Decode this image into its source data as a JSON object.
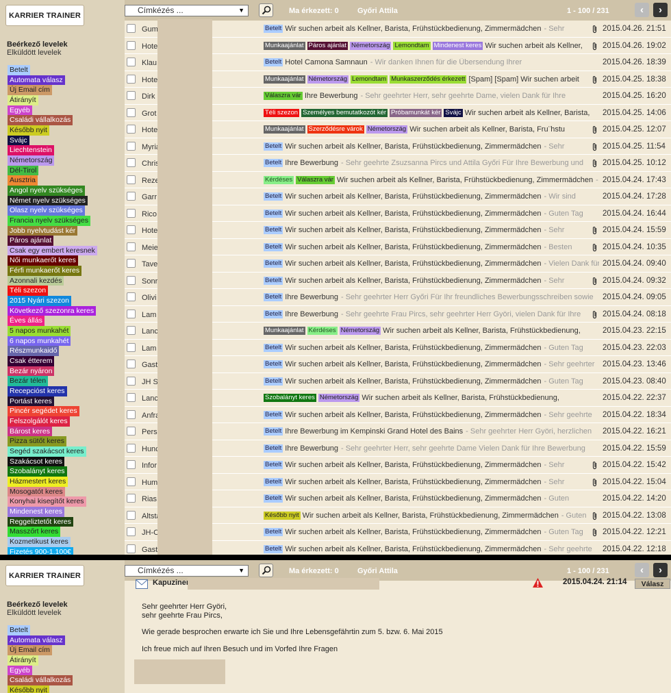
{
  "brand": "KARRIER TRAINER",
  "nav": {
    "inbox": "Beérkező levelek",
    "sent": "Elküldött levelek"
  },
  "labels": [
    {
      "text": "Betelt",
      "bg": "#aaccff",
      "fg": "#222"
    },
    {
      "text": "Automata válasz",
      "bg": "#6633cc",
      "fg": "#fff"
    },
    {
      "text": "Új Email cím",
      "bg": "#cc9966",
      "fg": "#222"
    },
    {
      "text": "Átirányít",
      "bg": "#ddee88",
      "fg": "#222"
    },
    {
      "text": "Egyéb",
      "bg": "#cc44cc",
      "fg": "#fff"
    },
    {
      "text": "Családi vállalkozás",
      "bg": "#aa5544",
      "fg": "#fff"
    },
    {
      "text": "Később nyit",
      "bg": "#cccc22",
      "fg": "#222"
    },
    {
      "text": "Svájc",
      "bg": "#111144",
      "fg": "#fff"
    },
    {
      "text": "Liechtenstein",
      "bg": "#dd1166",
      "fg": "#fff"
    },
    {
      "text": "Németország",
      "bg": "#bb99ee",
      "fg": "#222"
    },
    {
      "text": "Dél-Tirol",
      "bg": "#44bb44",
      "fg": "#222"
    },
    {
      "text": "Ausztria",
      "bg": "#ee8833",
      "fg": "#222"
    },
    {
      "text": "Angol nyelv szükséges",
      "bg": "#338822",
      "fg": "#fff"
    },
    {
      "text": "Német nyelv szükséges",
      "bg": "#222222",
      "fg": "#fff"
    },
    {
      "text": "Olasz nyelv szükséges",
      "bg": "#6677dd",
      "fg": "#fff"
    },
    {
      "text": "Francia nyelv szükséges",
      "bg": "#44dd44",
      "fg": "#222"
    },
    {
      "text": "Jobb nyelvtudást kér",
      "bg": "#997733",
      "fg": "#fff"
    },
    {
      "text": "Páros ajánlat",
      "bg": "#551133",
      "fg": "#fff"
    },
    {
      "text": "Csak egy embert keresnek",
      "bg": "#ccaaee",
      "fg": "#222"
    },
    {
      "text": "Női munkaerőt keres",
      "bg": "#660000",
      "fg": "#fff"
    },
    {
      "text": "Férfi munkaerőt keres",
      "bg": "#777711",
      "fg": "#fff"
    },
    {
      "text": "Azonnali kezdés",
      "bg": "#bbcc99",
      "fg": "#222"
    },
    {
      "text": "Téli szezon",
      "bg": "#ee1111",
      "fg": "#fff"
    },
    {
      "text": "2015 Nyári szezon",
      "bg": "#1188dd",
      "fg": "#fff"
    },
    {
      "text": "Következő szezonra keres",
      "bg": "#aa22dd",
      "fg": "#fff"
    },
    {
      "text": "Éves állás",
      "bg": "#ee2288",
      "fg": "#fff"
    },
    {
      "text": "5 napos munkahét",
      "bg": "#99dd33",
      "fg": "#222"
    },
    {
      "text": "6 napos munkahét",
      "bg": "#7766ee",
      "fg": "#fff"
    },
    {
      "text": "Részmunkaidő",
      "bg": "#6666aa",
      "fg": "#fff"
    },
    {
      "text": "Csak étterem",
      "bg": "#330033",
      "fg": "#fff"
    },
    {
      "text": "Bezár nyáron",
      "bg": "#cc3366",
      "fg": "#fff"
    },
    {
      "text": "Bezár télen",
      "bg": "#22bb99",
      "fg": "#222"
    },
    {
      "text": "Recepcióst keres",
      "bg": "#2233aa",
      "fg": "#fff"
    },
    {
      "text": "Portást keres",
      "bg": "#221133",
      "fg": "#fff"
    },
    {
      "text": "Pincér segédet keres",
      "bg": "#ee4433",
      "fg": "#fff"
    },
    {
      "text": "Felszolgálót keres",
      "bg": "#dd2244",
      "fg": "#fff"
    },
    {
      "text": "Bárost keres",
      "bg": "#cc3388",
      "fg": "#fff"
    },
    {
      "text": "Pizza sütőt keres",
      "bg": "#889922",
      "fg": "#222"
    },
    {
      "text": "Segéd szakácsot keres",
      "bg": "#77eecc",
      "fg": "#222"
    },
    {
      "text": "Szakácsot keres",
      "bg": "#111111",
      "fg": "#fff"
    },
    {
      "text": "Szobalányt keres",
      "bg": "#117711",
      "fg": "#fff"
    },
    {
      "text": "Házmestert keres",
      "bg": "#eeee22",
      "fg": "#222"
    },
    {
      "text": "Mosogatót keres",
      "bg": "#dd8888",
      "fg": "#222"
    },
    {
      "text": "Konyhai kisegítőt keres",
      "bg": "#ee99aa",
      "fg": "#222"
    },
    {
      "text": "Mindenest keres",
      "bg": "#9977dd",
      "fg": "#fff"
    },
    {
      "text": "Reggeliztetőt keres",
      "bg": "#224411",
      "fg": "#fff"
    },
    {
      "text": "Masszőrt keres",
      "bg": "#33dd33",
      "fg": "#222"
    },
    {
      "text": "Kozmetikust keres",
      "bg": "#aaccee",
      "fg": "#222"
    },
    {
      "text": "Fizetés 900-1.100€",
      "bg": "#11aaee",
      "fg": "#fff"
    }
  ],
  "toolbar": {
    "combo": "Címkézés ...",
    "today": "Ma érkezett: 0",
    "user": "Győri Attila",
    "range": "1 - 100 / 231",
    "prev": "‹",
    "next": "›"
  },
  "tagColors": {
    "Betelt": {
      "bg": "#aaccff",
      "fg": "#224"
    },
    "Munkaajánlat": {
      "bg": "#666666",
      "fg": "#fff"
    },
    "Páros ajánlat": {
      "bg": "#551133",
      "fg": "#fff"
    },
    "Németország": {
      "bg": "#bb99ee",
      "fg": "#222"
    },
    "Lemondtam": {
      "bg": "#99dd33",
      "fg": "#222"
    },
    "Mindenest keres": {
      "bg": "#9977dd",
      "fg": "#fff"
    },
    "Munkaszerződés érkezett": {
      "bg": "#99dd33",
      "fg": "#222"
    },
    "Válaszra vár": {
      "bg": "#66cc33",
      "fg": "#222"
    },
    "Téli szezon": {
      "bg": "#ee1111",
      "fg": "#fff"
    },
    "Személyes bemutatkozót kér": {
      "bg": "#226633",
      "fg": "#fff"
    },
    "Próbamunkát kér": {
      "bg": "#886688",
      "fg": "#fff"
    },
    "Svájc": {
      "bg": "#111144",
      "fg": "#fff"
    },
    "Szerződésre várok": {
      "bg": "#ee3311",
      "fg": "#fff"
    },
    "Kérdéses": {
      "bg": "#88ee88",
      "fg": "#225522"
    },
    "Szobalányt keres": {
      "bg": "#117711",
      "fg": "#fff"
    },
    "Később nyit": {
      "bg": "#cccc22",
      "fg": "#222"
    }
  },
  "emails": [
    {
      "sender": "Gum",
      "tags": [
        "Betelt"
      ],
      "subject": "Wir suchen arbeit als Kellner, Barista, Frühstückbedienung, Zimmermädchen",
      "preview": "- Sehr",
      "att": true,
      "date": "2015.04.26. 21:51"
    },
    {
      "sender": "Hote",
      "tags": [
        "Munkaajánlat",
        "Páros ajánlat",
        "Németország",
        "Lemondtam",
        "Mindenest keres"
      ],
      "subject": "Wir suchen arbeit als Kellner,",
      "preview": "",
      "att": true,
      "date": "2015.04.26. 19:02"
    },
    {
      "sender": "Klau",
      "tags": [
        "Betelt"
      ],
      "subject": "Hotel Camona Samnaun",
      "preview": "- Wir danken Ihnen für die Übersendung Ihrer",
      "att": false,
      "date": "2015.04.26. 18:39"
    },
    {
      "sender": "Hote",
      "tags": [
        "Munkaajánlat",
        "Németország",
        "Lemondtam",
        "Munkaszerződés érkezett"
      ],
      "subject": "[Spam] [Spam] Wir suchen arbeit",
      "preview": "",
      "att": true,
      "date": "2015.04.25. 18:38"
    },
    {
      "sender": "Dirk",
      "tags": [
        "Válaszra vár"
      ],
      "subject": "Ihre Bewerbung",
      "preview": "- Sehr geehrter Herr, sehr geehrte Dame, vielen Dank für Ihre",
      "att": false,
      "date": "2015.04.25. 16:20"
    },
    {
      "sender": "Grot",
      "tags": [
        "Téli szezon",
        "Személyes bemutatkozót kér",
        "Próbamunkát kér",
        "Svájc"
      ],
      "subject": "Wir suchen arbeit als Kellner, Barista,",
      "preview": "",
      "att": false,
      "date": "2015.04.25. 14:06"
    },
    {
      "sender": "Hote",
      "tags": [
        "Munkaajánlat",
        "Szerződésre várok",
        "Németország"
      ],
      "subject": "Wir suchen arbeit als Kellner, Barista, Fru¨hstu",
      "preview": "",
      "att": true,
      "date": "2015.04.25. 12:07"
    },
    {
      "sender": "Myria                                  izerhof St.",
      "tags": [
        "Betelt"
      ],
      "subject": "Wir suchen arbeit als Kellner, Barista, Frühstückbedienung, Zimmermädchen",
      "preview": "- Sehr",
      "att": true,
      "date": "2015.04.25. 11:54"
    },
    {
      "sender": "Chris                                  ASTORIA",
      "tags": [
        "Betelt"
      ],
      "subject": "Ihre Bewerbung",
      "preview": "- Sehr geehrte Zsuzsanna Pircs und Attila Győri Für Ihre Bewerbung und",
      "att": true,
      "date": "2015.04.25. 10:12"
    },
    {
      "sender": "Reze                                   ersee (2)",
      "tags": [
        "Kérdéses",
        "Válaszra vár"
      ],
      "subject": "Wir suchen arbeit als Kellner, Barista, Frühstückbedienung, Zimmermädchen",
      "preview": "-",
      "att": false,
      "date": "2015.04.24. 17:43"
    },
    {
      "sender": "Garr",
      "tags": [
        "Betelt"
      ],
      "subject": "Wir suchen arbeit als Kellner, Barista, Frühstückbedienung, Zimmermädchen",
      "preview": "- Wir sind",
      "att": false,
      "date": "2015.04.24. 17:28"
    },
    {
      "sender": "Rico                                   unststuben",
      "tags": [
        "Betelt"
      ],
      "subject": "Wir suchen arbeit als Kellner, Barista, Frühstückbedienung, Zimmermädchen",
      "preview": "- Guten Tag",
      "att": false,
      "date": "2015.04.24. 16:44"
    },
    {
      "sender": "Hote                                   aken",
      "tags": [
        "Betelt"
      ],
      "subject": "Wir suchen arbeit als Kellner, Barista, Frühstückbedienung, Zimmermädchen",
      "preview": "- Sehr",
      "att": true,
      "date": "2015.04.24. 15:59"
    },
    {
      "sender": "Meie",
      "tags": [
        "Betelt"
      ],
      "subject": "Wir suchen arbeit als Kellner, Barista, Frühstückbedienung, Zimmermädchen",
      "preview": "- Besten",
      "att": true,
      "date": "2015.04.24. 10:35"
    },
    {
      "sender": "Tave",
      "tags": [
        "Betelt"
      ],
      "subject": "Wir suchen arbeit als Kellner, Barista, Frühstückbedienung, Zimmermädchen",
      "preview": "- Vielen Dank für",
      "att": false,
      "date": "2015.04.24. 09:40"
    },
    {
      "sender": "Sonr                                   ella - Sonneck",
      "tags": [
        "Betelt"
      ],
      "subject": "Wir suchen arbeit als Kellner, Barista, Frühstückbedienung, Zimmermädchen",
      "preview": "- Sehr",
      "att": true,
      "date": "2015.04.24. 09:32"
    },
    {
      "sender": "Olivi                                  2)",
      "tags": [
        "Betelt"
      ],
      "subject": "Ihre Bewerbung",
      "preview": "- Sehr geehrter Herr Győri Für Ihr freundliches Bewerbungsschreiben sowie",
      "att": false,
      "date": "2015.04.24. 09:05"
    },
    {
      "sender": "Lam",
      "tags": [
        "Betelt"
      ],
      "subject": "Ihre Bewerbung",
      "preview": "- Sehr geehrte Frau Pircs, sehr geehrter Herr Györi, vielen Dank für Ihre",
      "att": true,
      "date": "2015.04.24. 08:18"
    },
    {
      "sender": "Lanc",
      "tags": [
        "Munkaajánlat",
        "Kérdéses",
        "Németország"
      ],
      "subject": "Wir suchen arbeit als Kellner, Barista, Frühstückbedienung,",
      "preview": "",
      "att": false,
      "date": "2015.04.23. 22:15"
    },
    {
      "sender": "Lam",
      "tags": [
        "Betelt"
      ],
      "subject": "Wir suchen arbeit als Kellner, Barista, Frühstückbedienung, Zimmermädchen",
      "preview": "- Guten Tag",
      "att": false,
      "date": "2015.04.23. 22:03"
    },
    {
      "sender": "Gast",
      "tags": [
        "Betelt"
      ],
      "subject": "Wir suchen arbeit als Kellner, Barista, Frühstückbedienung, Zimmermädchen",
      "preview": "- Sehr geehrter",
      "att": false,
      "date": "2015.04.23. 13:46"
    },
    {
      "sender": "JH S",
      "tags": [
        "Betelt"
      ],
      "subject": "Wir suchen arbeit als Kellner, Barista, Frühstückbedienung, Zimmermädchen",
      "preview": "- Guten Tag",
      "att": false,
      "date": "2015.04.23. 08:40"
    },
    {
      "sender": "Lanc                                   tersheim",
      "tags": [
        "Szobalányt keres",
        "Németország"
      ],
      "subject": "Wir suchen arbeit als Kellner, Barista, Frühstückbedienung,",
      "preview": "",
      "att": false,
      "date": "2015.04.22. 22:37"
    },
    {
      "sender": "Anfra",
      "tags": [
        "Betelt"
      ],
      "subject": "Wir suchen arbeit als Kellner, Barista, Frühstückbedienung, Zimmermädchen",
      "preview": "- Sehr geehrte",
      "att": false,
      "date": "2015.04.22. 18:34"
    },
    {
      "sender": "Pers                                   desbains",
      "tags": [
        "Betelt"
      ],
      "subject": "Ihre Bewerbung im Kempinski Grand Hotel des Bains",
      "preview": "- Sehr geehrter Herr Györi,  herzlichen",
      "att": false,
      "date": "2015.04.22. 16:21"
    },
    {
      "sender": "Hunc",
      "tags": [
        "Betelt"
      ],
      "subject": "Ihre Bewerbung",
      "preview": "- Sehr geehrter Herr, sehr geehrte Dame Vielen Dank für Ihre Bewerbung",
      "att": false,
      "date": "2015.04.22. 15:59"
    },
    {
      "sender": "Infor",
      "tags": [
        "Betelt"
      ],
      "subject": "Wir suchen arbeit als Kellner, Barista, Frühstückbedienung, Zimmermädchen",
      "preview": "- Sehr",
      "att": true,
      "date": "2015.04.22. 15:42"
    },
    {
      "sender": "Hum",
      "tags": [
        "Betelt"
      ],
      "subject": "Wir suchen arbeit als Kellner, Barista, Frühstückbedienung, Zimmermädchen",
      "preview": "- Sehr",
      "att": true,
      "date": "2015.04.22. 15:04"
    },
    {
      "sender": "Rias",
      "tags": [
        "Betelt"
      ],
      "subject": "Wir suchen arbeit als Kellner, Barista, Frühstückbedienung, Zimmermädchen",
      "preview": "- Guten",
      "att": false,
      "date": "2015.04.22. 14:20"
    },
    {
      "sender": "Altsta                                 berg",
      "tags": [
        "Később nyit"
      ],
      "subject": "Wir suchen arbeit als Kellner, Barista, Frühstückbedienung, Zimmermädchen",
      "preview": "- Guten",
      "att": true,
      "date": "2015.04.22. 13:08"
    },
    {
      "sender": "JH-C",
      "tags": [
        "Betelt"
      ],
      "subject": "Wir suchen arbeit als Kellner, Barista, Frühstückbedienung, Zimmermädchen",
      "preview": "- Guten Tag",
      "att": true,
      "date": "2015.04.22. 12:21"
    },
    {
      "sender": "Gast                                   harl",
      "tags": [
        "Betelt"
      ],
      "subject": "Wir suchen arbeit als Kellner, Barista, Frühstückbedienung, Zimmermädchen",
      "preview": "- Sehr geehrte",
      "att": false,
      "date": "2015.04.22. 12:18"
    }
  ],
  "detail": {
    "from": "Kapuziner",
    "date": "2015.04.24. 21:14",
    "reply": "Válasz",
    "body": [
      "Sehr geehrter Herr Györi,",
      "sehr geehrte Frau Pircs,",
      "Wie gerade besprochen erwarte ich Sie und Ihre Lebensgefährtin zum 5. bzw. 6. Mai 2015",
      "Ich freue mich auf Ihren Besuch und im Vorfed Ihre Fragen"
    ]
  }
}
